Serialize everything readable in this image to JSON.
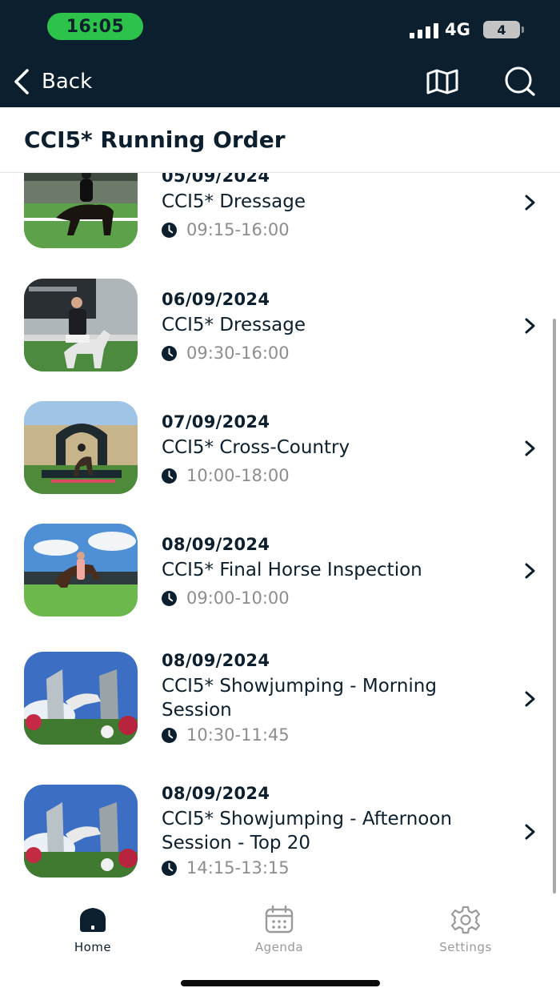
{
  "status_bar": {
    "time": "16:05",
    "network": "4G",
    "battery": "4"
  },
  "header": {
    "back_label": "Back"
  },
  "page": {
    "title": "CCI5* Running Order"
  },
  "events": [
    {
      "date": "05/09/2024",
      "title": "CCI5* Dressage",
      "time": "09:15-16:00"
    },
    {
      "date": "06/09/2024",
      "title": "CCI5* Dressage",
      "time": "09:30-16:00"
    },
    {
      "date": "07/09/2024",
      "title": "CCI5* Cross-Country",
      "time": "10:00-18:00"
    },
    {
      "date": "08/09/2024",
      "title": "CCI5* Final Horse Inspection",
      "time": "09:00-10:00"
    },
    {
      "date": "08/09/2024",
      "title": "CCI5* Showjumping - Morning Session",
      "time": "10:30-11:45"
    },
    {
      "date": "08/09/2024",
      "title": "CCI5* Showjumping - Afternoon Session - Top 20",
      "time": "14:15-13:15"
    }
  ],
  "tabs": [
    {
      "label": "Home",
      "icon": "home-icon",
      "active": true
    },
    {
      "label": "Agenda",
      "icon": "calendar-icon",
      "active": false
    },
    {
      "label": "Settings",
      "icon": "gear-icon",
      "active": false
    }
  ],
  "colors": {
    "header_bg": "#0b1f2e",
    "time_pill": "#2dc24a",
    "text_dark": "#0c1f2e",
    "text_muted": "#8d8d8d",
    "tab_inactive": "#9a9a9a"
  }
}
